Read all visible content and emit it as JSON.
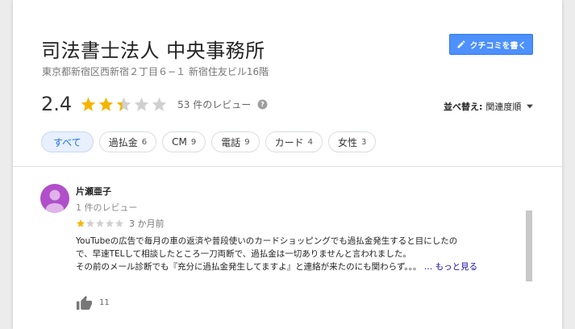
{
  "place": {
    "name": "司法書士法人 中央事務所",
    "address": "東京都新宿区西新宿２丁目６−１ 新宿住友ビル16階"
  },
  "actions": {
    "write_review_label": "クチコミを書く",
    "write_review_icon": "pencil-icon"
  },
  "summary": {
    "rating": "2.4",
    "rating_value": 2.4,
    "max_stars": 5,
    "review_count_text": "53 件のレビュー",
    "help_icon": "help-circle-icon"
  },
  "sort": {
    "label": "並べ替え:",
    "value": "関連度順"
  },
  "filters": [
    {
      "label": "すべて",
      "count": "",
      "active": true
    },
    {
      "label": "過払金",
      "count": "6",
      "active": false
    },
    {
      "label": "CM",
      "count": "9",
      "active": false
    },
    {
      "label": "電話",
      "count": "9",
      "active": false
    },
    {
      "label": "カード",
      "count": "4",
      "active": false
    },
    {
      "label": "女性",
      "count": "3",
      "active": false
    }
  ],
  "review": {
    "author": "片瀬亜子",
    "meta": "1 件のレビュー",
    "stars": 1,
    "date": "3 か月前",
    "text_lines": [
      "YouTubeの広告で毎月の車の返済や普段使いのカードショッピングでも過払金発生すると目にしたの",
      "で、早速TELして相談したところ一刀両断で、過払金は一切ありませんと言われました。",
      "その前のメール診断でも『充分に過払金発生してますよ』と連絡が来たのにも関わらず。。。"
    ],
    "more_label": "… もっと見る",
    "like_count": "11",
    "like_icon": "thumbs-up-icon"
  },
  "colors": {
    "star_filled": "#f5b400",
    "star_empty": "#d0d0d0",
    "button_blue": "#4d90fe",
    "chip_active_bg": "#e8f0fe",
    "avatar_bg": "#b04fc9"
  }
}
